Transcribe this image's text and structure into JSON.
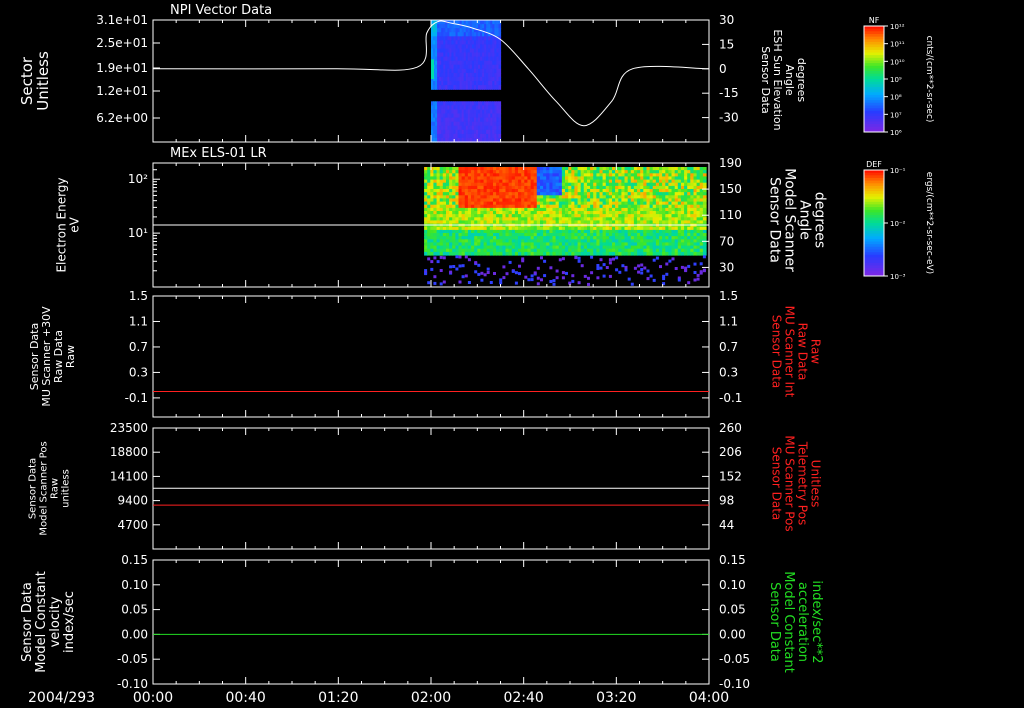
{
  "date_label": "2004/293",
  "time_ticks": [
    "00:00",
    "00:40",
    "01:20",
    "02:00",
    "02:40",
    "03:20",
    "04:00"
  ],
  "time_range_hours": [
    0,
    4
  ],
  "colors": {
    "background": "#000000",
    "axis": "#ffffff",
    "red_trace": "#ff2020",
    "green_trace": "#22dd22"
  },
  "chart_data": [
    {
      "type": "heatmap",
      "title": "NPI Vector Data",
      "ylabel": "Sector Unitless",
      "y_ticks": [
        "3.1e+01",
        "2.5e+01",
        "1.9e+01",
        "1.2e+01",
        "6.2e+00"
      ],
      "ylim": [
        0,
        31
      ],
      "heat_x_hours": [
        2.0,
        2.5
      ],
      "heat_gap_sector": [
        10.5,
        12.5
      ],
      "right_axis": {
        "label_lines": [
          "Sensor Data",
          "ESH Sun Elevation",
          "Angle",
          "degrees"
        ],
        "ticks": [
          30,
          15,
          0,
          -15,
          -30
        ],
        "ylim": [
          -45,
          30
        ],
        "color": "#ffffff"
      },
      "line_series": {
        "axis": "right",
        "color": "#ffffff",
        "x_hours": [
          0,
          1.3,
          1.9,
          1.97,
          2.05,
          2.15,
          2.3,
          2.5,
          2.7,
          2.9,
          3.1,
          3.3,
          3.45,
          4.0
        ],
        "values": [
          0,
          0,
          1,
          22,
          29,
          28,
          25,
          18,
          0,
          -20,
          -35,
          -20,
          0,
          0
        ]
      },
      "colorbar": {
        "label": "NF",
        "units": "cnts/(cm**2-sr-sec)",
        "ticks": [
          "10¹²",
          "10¹¹",
          "10¹⁰",
          "10⁹",
          "10⁸",
          "10⁷",
          "10⁶"
        ]
      }
    },
    {
      "type": "heatmap",
      "title": "MEx ELS-01 LR",
      "ylabel_lines": [
        "Electron Energy",
        "eV"
      ],
      "y_scale": "log",
      "y_tick_labels": [
        "10²",
        "10¹"
      ],
      "y_tick_values": [
        100,
        10
      ],
      "ylim": [
        1,
        200
      ],
      "heat_x_hours": [
        1.95,
        4.0
      ],
      "right_axis": {
        "label_lines": [
          "Sensor Data",
          "Model Scanner",
          "Angle",
          "degrees"
        ],
        "ticks": [
          190,
          150,
          110,
          70,
          30
        ],
        "ylim": [
          0,
          190
        ],
        "color": "#ffffff"
      },
      "line_series": {
        "axis": "right",
        "color": "#ffffff",
        "x_hours": [
          0,
          4
        ],
        "values": [
          95,
          95
        ]
      },
      "colorbar": {
        "label": "DEF",
        "units": "ergs/(cm**2-sr-sec-eV)",
        "ticks": [
          "10⁻¹",
          "10⁻²",
          "10⁻³"
        ]
      }
    },
    {
      "type": "line",
      "ylabel_lines": [
        "Sensor Data",
        "MU Scanner +30V",
        "Raw Data",
        "Raw"
      ],
      "y_ticks": [
        "1.5",
        "1.1",
        "0.7",
        "0.3",
        "-0.1"
      ],
      "ylim": [
        -0.4,
        1.5
      ],
      "right_axis": {
        "label_lines": [
          "Sensor Data",
          "MU Scanner Int",
          "Raw Data",
          "Raw"
        ],
        "ticks": [
          "1.5",
          "1.1",
          "0.7",
          "0.3",
          "-0.1"
        ],
        "ylim": [
          -0.4,
          1.5
        ],
        "color": "#ff2020"
      },
      "series": [
        {
          "axis": "right",
          "color": "#ff2020",
          "x_hours": [
            0,
            4
          ],
          "values": [
            0,
            0
          ]
        }
      ]
    },
    {
      "type": "line",
      "ylabel_lines": [
        "Sensor Data",
        "Model Scanner Pos",
        "Raw",
        "unitless"
      ],
      "y_ticks": [
        "23500",
        "18800",
        "14100",
        "9400",
        "4700"
      ],
      "ylim": [
        0,
        23500
      ],
      "right_axis": {
        "label_lines": [
          "Sensor Data",
          "MU Scanner Pos",
          "Telemetry Pos",
          "Unitless"
        ],
        "ticks": [
          "260",
          "206",
          "152",
          "98",
          "44"
        ],
        "ylim": [
          -10,
          260
        ],
        "color": "#ff2020"
      },
      "series": [
        {
          "axis": "left",
          "color": "#ffffff",
          "x_hours": [
            0,
            4
          ],
          "values": [
            11800,
            11800
          ]
        },
        {
          "axis": "right",
          "color": "#ff2020",
          "x_hours": [
            0,
            4
          ],
          "values": [
            88,
            88
          ]
        }
      ]
    },
    {
      "type": "line",
      "ylabel_lines": [
        "Sensor Data",
        "Model Constant",
        "velocity",
        "index/sec"
      ],
      "y_ticks": [
        "0.15",
        "0.10",
        "0.05",
        "0.00",
        "-0.05",
        "-0.10"
      ],
      "ylim": [
        -0.1,
        0.15
      ],
      "right_axis": {
        "label_lines": [
          "Sensor Data",
          "Model Constant",
          "acceleration",
          "index/sec**2"
        ],
        "ticks": [
          "0.15",
          "0.10",
          "0.05",
          "0.00",
          "-0.05",
          "-0.10"
        ],
        "ylim": [
          -0.1,
          0.15
        ],
        "color": "#22dd22"
      },
      "series": [
        {
          "axis": "right",
          "color": "#22dd22",
          "x_hours": [
            0,
            4
          ],
          "values": [
            0,
            0
          ]
        }
      ]
    }
  ]
}
